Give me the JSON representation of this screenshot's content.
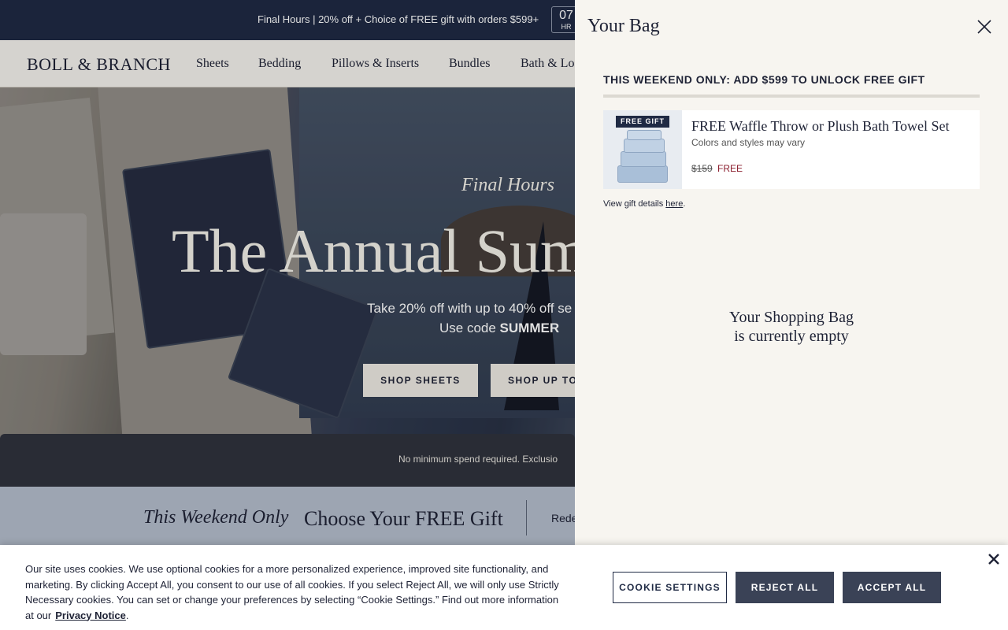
{
  "announcement": {
    "text": "Final Hours | 20% off + Choice of FREE gift with orders $599+",
    "countdown_value": "07",
    "countdown_unit": "HR"
  },
  "nav": {
    "logo": "BOLL & BRANCH",
    "items": [
      "Sheets",
      "Bedding",
      "Pillows & Inserts",
      "Bundles",
      "Bath & Lo"
    ]
  },
  "hero": {
    "kicker": "Final Hours",
    "title": "The Annual Sum",
    "subtitle": "Take 20% off with up to 40% off se",
    "code_prefix": "Use code ",
    "code": "SUMMER",
    "buttons": [
      "SHOP SHEETS",
      "SHOP UP TO"
    ],
    "disclaimer": "No minimum spend required. Exclusio"
  },
  "gift_strip": {
    "kicker": "This Weekend Only",
    "title": "Choose Your FREE Gift",
    "redeem": "Rede"
  },
  "bag": {
    "title": "Your Bag",
    "promo": "THIS WEEKEND ONLY: ADD $599 TO UNLOCK FREE GIFT",
    "gift": {
      "badge": "FREE GIFT",
      "name": "FREE Waffle Throw or Plush Bath Towel Set",
      "note": "Colors and styles may vary",
      "original_price": "$159",
      "price": "FREE"
    },
    "details_prefix": "View gift details ",
    "details_link": "here",
    "details_suffix": ".",
    "empty_line1": "Your Shopping Bag",
    "empty_line2": "is currently empty"
  },
  "cookie": {
    "text": "Our site uses cookies. We use optional cookies for a more personalized experience, improved site functionality, and marketing. By clicking Accept All, you consent to our use of all cookies. If you select Reject All, we will only use Strictly Necessary cookies. You can set or change your preferences by selecting “Cookie Settings.” Find out more information at our",
    "link": "Privacy Notice",
    "link_suffix": ".",
    "settings_label": "COOKIE SETTINGS",
    "reject_label": "REJECT ALL",
    "accept_label": "ACCEPT ALL"
  },
  "colors": {
    "navy": "#1f2a44",
    "drawer_bg": "#f7f5f0",
    "gift_strip": "#b3bccb",
    "sale_red": "#8b1e2e"
  }
}
